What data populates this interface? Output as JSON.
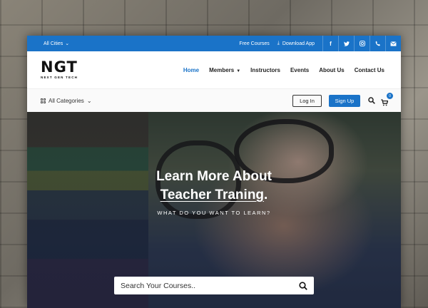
{
  "topbar": {
    "city_select": "All Cities",
    "free_courses": "Free Courses",
    "download_app": "Download App",
    "social": [
      "facebook-icon",
      "twitter-icon",
      "instagram-icon",
      "phone-icon",
      "mail-icon"
    ]
  },
  "nav": {
    "logo": "NGT",
    "logo_sub": "NEXT GEN TECH",
    "items": [
      {
        "label": "Home",
        "active": true
      },
      {
        "label": "Members",
        "dropdown": true
      },
      {
        "label": "Instructors"
      },
      {
        "label": "Events"
      },
      {
        "label": "About Us"
      },
      {
        "label": "Contact Us"
      }
    ]
  },
  "catbar": {
    "categories_label": "All Categories",
    "login_label": "Log In",
    "signup_label": "Sign Up",
    "cart_count": "0"
  },
  "hero": {
    "title_line1": "Learn More About",
    "title_line2": "Teacher Traning",
    "title_line2_suffix": ".",
    "subtitle": "WHAT DO YOU WANT TO LEARN?",
    "search_placeholder": "Search Your Courses.."
  },
  "colors": {
    "accent": "#1a73c8"
  }
}
